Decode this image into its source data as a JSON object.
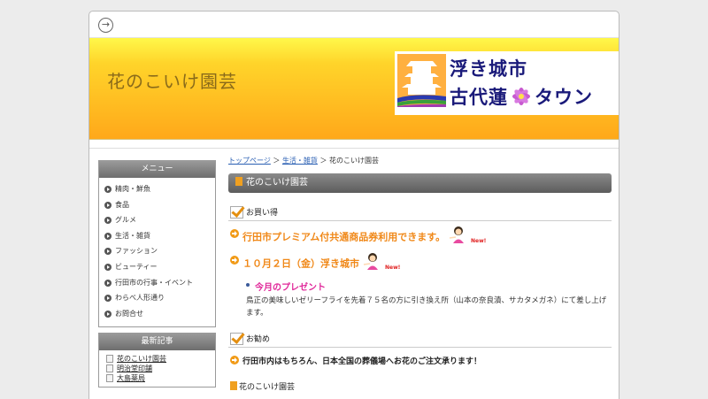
{
  "topbar": {
    "nav_icon": "arrow-right-circle-icon",
    "nav_glyph": "→"
  },
  "banner": {
    "site_title": "花のこいけ園芸",
    "logo_line1": "浮き城市",
    "logo_line2a": "古代蓮",
    "logo_line2b": "タウン"
  },
  "sidebar": {
    "menu_title": "メニュー",
    "menu_items": [
      "精肉・鮮魚",
      "食品",
      "グルメ",
      "生活・雑貨",
      "ファッション",
      "ビューティー",
      "行田市の行事・イベント",
      "わらべ人形通り",
      "お問合せ"
    ],
    "recent_title": "最新記事",
    "recent_items": [
      "花のこいけ園芸",
      "明治堂印舗",
      "大島薬局"
    ]
  },
  "breadcrumb": {
    "home": "トップページ",
    "sep1": " ＞ ",
    "category": "生活・雑貨",
    "sep2": " ＞ ",
    "current": "花のこいけ園芸"
  },
  "main": {
    "page_heading": "花のこいけ園芸",
    "section1_title": "お買い得",
    "notice1": "行田市プレミアム付共通商品券利用できます。",
    "notice2": "１０月２日（金）浮き城市",
    "new_badge": "New!",
    "present_title": "今月のプレゼント",
    "present_desc": "鳥正の美味しいゼリーフライを先着７５名の方に引き換え所（山本の奈良漬、サカタメガネ）にて差し上げます。",
    "section2_title": "お勧め",
    "recommend": "行田市内はもちろん、日本全国の葬儀場へお花のご注文承ります！",
    "footer_title": "花のこいけ園芸"
  }
}
